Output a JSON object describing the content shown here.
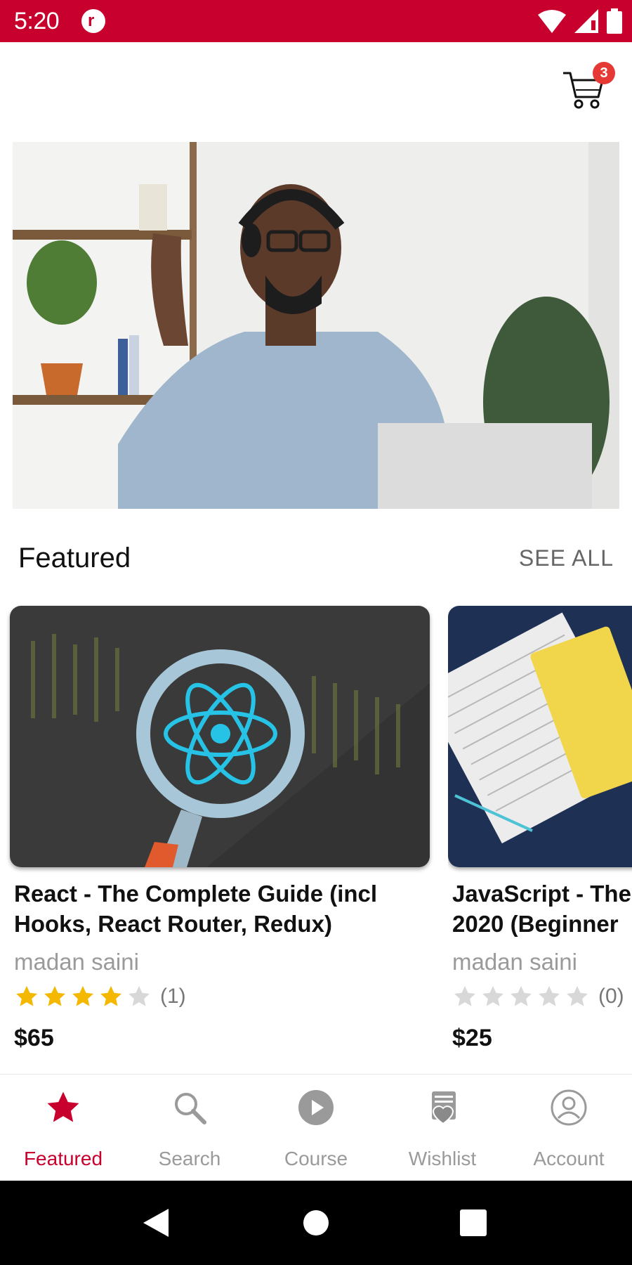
{
  "status_bar": {
    "time": "5:20",
    "app_icon": "app-notification-icon",
    "icons": [
      "wifi-icon",
      "cellular-signal-icon",
      "battery-icon"
    ]
  },
  "header": {
    "cart_icon": "cart-icon",
    "cart_count": "3"
  },
  "hero": {
    "image": "person-with-headset-at-laptop"
  },
  "featured": {
    "title": "Featured",
    "see_all": "SEE ALL"
  },
  "courses": [
    {
      "title_line1": "React - The Complete Guide (incl",
      "title_line2": "Hooks, React Router, Redux)",
      "author": "madan saini",
      "rating": 4,
      "rating_count": "(1)",
      "price": "$65",
      "thumb": "react-magnifier-thumbnail"
    },
    {
      "title_line1": "JavaScript - The",
      "title_line2": "2020 (Beginner",
      "author": "madan saini",
      "rating": 0,
      "rating_count": "(0)",
      "price": "$25",
      "thumb": "notebook-thumbnail"
    }
  ],
  "bottom_nav": [
    {
      "label": "Featured",
      "icon": "star-icon",
      "active": true
    },
    {
      "label": "Search",
      "icon": "search-icon",
      "active": false
    },
    {
      "label": "Course",
      "icon": "play-circle-icon",
      "active": false
    },
    {
      "label": "Wishlist",
      "icon": "wishlist-icon",
      "active": false
    },
    {
      "label": "Account",
      "icon": "account-icon",
      "active": false
    }
  ],
  "colors": {
    "primary": "#c8002e",
    "star_filled": "#f5b800",
    "star_empty": "#d8d8d8",
    "inactive": "#9a9a9a"
  },
  "system_nav": [
    "back-icon",
    "home-icon",
    "recents-icon"
  ]
}
